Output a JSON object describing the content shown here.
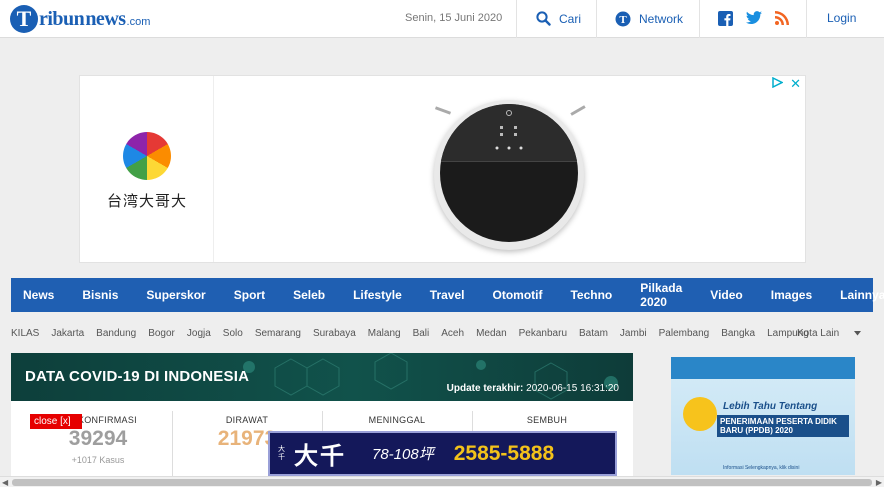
{
  "header": {
    "logo_main": "ribun",
    "logo_t": "T",
    "logo_news": "news",
    "logo_com": ".com",
    "date": "Senin, 15 Juni 2020",
    "search_label": "Cari",
    "network_label": "Network",
    "login_label": "Login"
  },
  "ad": {
    "brand_text": "台湾大哥大",
    "close_label": "✕"
  },
  "nav": {
    "items": [
      "News",
      "Bisnis",
      "Superskor",
      "Sport",
      "Seleb",
      "Lifestyle",
      "Travel",
      "Otomotif",
      "Techno",
      "Pilkada 2020",
      "Video",
      "Images"
    ],
    "more_label": "Lainnya"
  },
  "subnav": {
    "items": [
      "KILAS",
      "Jakarta",
      "Bandung",
      "Bogor",
      "Jogja",
      "Solo",
      "Semarang",
      "Surabaya",
      "Malang",
      "Bali",
      "Aceh",
      "Medan",
      "Pekanbaru",
      "Batam",
      "Jambi",
      "Palembang",
      "Bangka",
      "Lampung"
    ],
    "more_label": "Kota Lain"
  },
  "covid": {
    "title": "DATA COVID-19 DI INDONESIA",
    "update_label": "Update terakhir:",
    "update_value": "2020-06-15 16:31:20",
    "stats": [
      {
        "label": "TERKONFIRMASI",
        "value": "39294",
        "sub": "+1017 Kasus",
        "color": "#9e9e9e"
      },
      {
        "label": "DIRAWAT",
        "value": "21973",
        "sub": "",
        "color": "#e8b37a"
      },
      {
        "label": "MENINGGAL",
        "value": "",
        "sub": "",
        "color": "#d9534f"
      },
      {
        "label": "SEMBUH",
        "value": "",
        "sub": "",
        "color": "#4caf50"
      }
    ],
    "close_label": "close [x]"
  },
  "bottom_ad": {
    "small_text": "大千",
    "brand": "大千",
    "range": "78-108坪",
    "phone": "2585-5888"
  },
  "side_ad": {
    "line1": "Lebih Tahu Tentang",
    "line2": "PENERIMAAN PESERTA DIDIK BARU (PPDB) 2020",
    "line3": "Informasi Selengkapnya, klik disini"
  }
}
